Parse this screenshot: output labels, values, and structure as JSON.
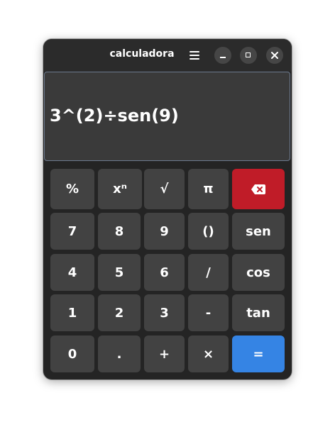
{
  "window": {
    "title": "calculadora"
  },
  "display": {
    "expression": "3^(2)÷sen(9)"
  },
  "keys": {
    "percent": "%",
    "power": "xⁿ",
    "sqrt": "√",
    "pi": "π",
    "seven": "7",
    "eight": "8",
    "nine": "9",
    "parens": "()",
    "sen": "sen",
    "four": "4",
    "five": "5",
    "six": "6",
    "divide": "/",
    "cos": "cos",
    "one": "1",
    "two": "2",
    "three": "3",
    "minus": "-",
    "tan": "tan",
    "zero": "0",
    "dot": ".",
    "plus": "+",
    "multiply": "×",
    "equals": "="
  },
  "icons": {
    "menu": "hamburger-menu-icon",
    "minimize": "minimize-icon",
    "maximize": "maximize-icon",
    "close": "close-icon",
    "backspace": "backspace-icon"
  },
  "colors": {
    "window_bg": "#242424",
    "key_bg": "#424242",
    "backspace_bg": "#c01c28",
    "equals_bg": "#3584e4"
  }
}
